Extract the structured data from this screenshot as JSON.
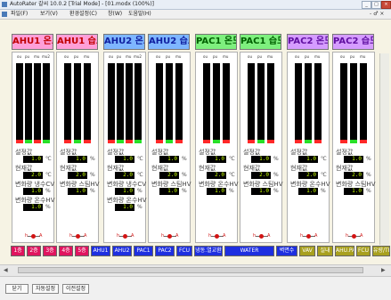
{
  "window": {
    "title": "AutoRater 갈씨 10.0.2 [Trial Mode] - [01.modx (100%)]",
    "minimize_glyph": "_",
    "maximize_glyph": "□",
    "close_glyph": "×"
  },
  "menu": {
    "file": "파일(F)",
    "view": "보기(V)",
    "env": "환경설정(C)",
    "window": "창(W)",
    "help": "도움말(H)",
    "right_controls": "- ♂ ×"
  },
  "panel_common": {
    "column_labels": [
      "ou",
      "pu",
      "mu",
      "mu2"
    ],
    "setpoint_label": "설정값",
    "current_label": "현재값",
    "setpoint_value": "1.0",
    "current_value": "2.0",
    "switch_left": "h",
    "switch_right": "A"
  },
  "panels": [
    {
      "header": "AHU1 온도",
      "header_color": "pink",
      "setpoint_unit": "℃",
      "current_unit": "℃",
      "delta_label": "변화량 냉수CV",
      "delta_value": "1.0",
      "delta_unit": "%",
      "extra_label": "변화량 온수HV",
      "extra_value": "1.0",
      "extra_unit": "%"
    },
    {
      "header": "AHU1 습도",
      "header_color": "pink",
      "setpoint_unit": "%",
      "current_unit": "%",
      "delta_label": "변화량 스팀HV",
      "delta_value": "1.0",
      "delta_unit": "%"
    },
    {
      "header": "AHU2 온도",
      "header_color": "blue",
      "setpoint_unit": "℃",
      "current_unit": "℃",
      "delta_label": "변화량 냉수CV",
      "delta_value": "1.0",
      "delta_unit": "%",
      "extra_label": "변화량 온수HV",
      "extra_value": "1.0",
      "extra_unit": "%"
    },
    {
      "header": "AHU2 습도",
      "header_color": "blue",
      "setpoint_unit": "%",
      "current_unit": "%",
      "delta_label": "변화량 스팀HV",
      "delta_value": "1.0",
      "delta_unit": "%"
    },
    {
      "header": "PAC1 온도",
      "header_color": "green",
      "setpoint_unit": "℃",
      "current_unit": "℃",
      "delta_label": "변화량 온수HV",
      "delta_value": "1.0",
      "delta_unit": "%"
    },
    {
      "header": "PAC1 습도",
      "header_color": "green",
      "setpoint_unit": "%",
      "current_unit": "%",
      "delta_label": "변화량 스팀HV",
      "delta_value": "1.0",
      "delta_unit": "%"
    },
    {
      "header": "PAC2 온도",
      "header_color": "purple",
      "setpoint_unit": "℃",
      "current_unit": "℃",
      "delta_label": "변화량 온수HV",
      "delta_value": "1.0",
      "delta_unit": "%"
    },
    {
      "header": "PAC2 습도",
      "header_color": "purple",
      "setpoint_unit": "%",
      "current_unit": "%",
      "delta_label": "변화량 스팀HV",
      "delta_value": "1.0",
      "delta_unit": "%"
    }
  ],
  "nav_buttons": [
    {
      "label": "1층",
      "color": "red"
    },
    {
      "label": "2층",
      "color": "red"
    },
    {
      "label": "3층",
      "color": "red"
    },
    {
      "label": "4층",
      "color": "red"
    },
    {
      "label": "5층",
      "color": "red"
    },
    {
      "label": "AHU1",
      "color": "blue"
    },
    {
      "label": "AHU2",
      "color": "blue"
    },
    {
      "label": "PAC1",
      "color": "blue"
    },
    {
      "label": "PAC2",
      "color": "blue"
    },
    {
      "label": "FCU",
      "color": "blue"
    },
    {
      "label": "냉동.열교환",
      "color": "blue"
    },
    {
      "label": "WATER",
      "color": "blue"
    },
    {
      "label": "벽면수",
      "color": "blue"
    },
    {
      "label": "VAV",
      "color": "olive"
    },
    {
      "label": "실내",
      "color": "olive"
    },
    {
      "label": "AHU.PAC",
      "color": "olive"
    },
    {
      "label": "FCU",
      "color": "olive"
    },
    {
      "label": "유량/TEX",
      "color": "olive"
    }
  ],
  "bottom_buttons": {
    "close": "닫기",
    "auto": "자동설정",
    "prev": "이전설정"
  },
  "colors": {
    "value_text": "#c8ff00",
    "value_box": "#000000",
    "workarea": "#f6f3e4"
  }
}
